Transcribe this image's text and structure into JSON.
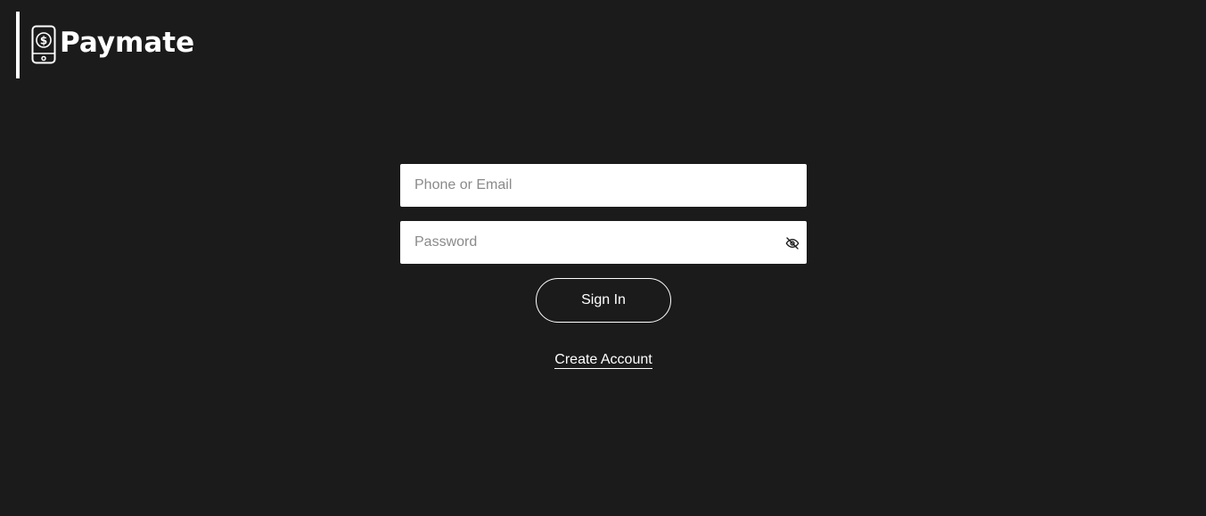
{
  "brand": {
    "name": "Paymate",
    "icon": "phone-dollar-icon"
  },
  "login_form": {
    "identifier_placeholder": "Phone or Email",
    "password_placeholder": "Password",
    "password_visibility_icon": "eye-off-icon",
    "sign_in_label": "Sign In",
    "create_account_label": "Create Account"
  },
  "colors": {
    "background": "#1b1b1b",
    "text": "#ffffff",
    "field_background": "#ffffff",
    "placeholder": "#8a8a8a"
  }
}
